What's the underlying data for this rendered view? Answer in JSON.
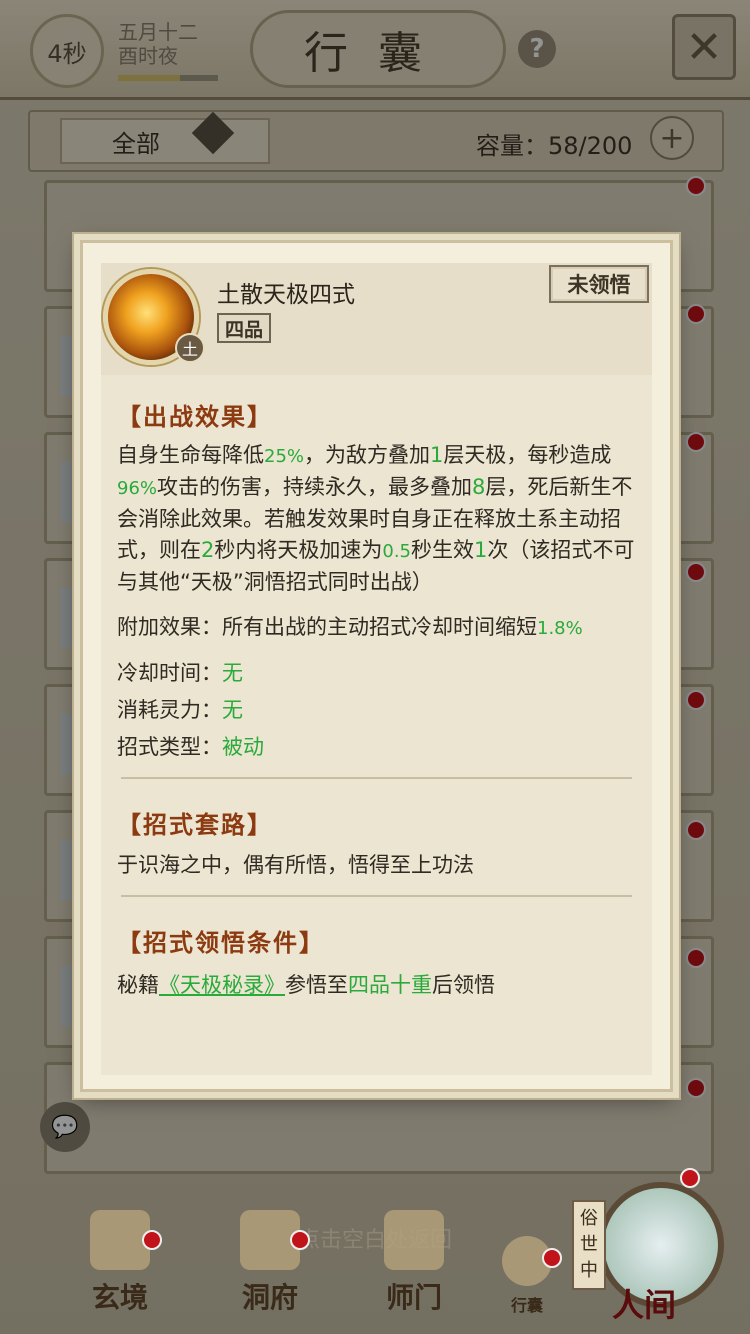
{
  "header": {
    "timer": "4秒",
    "date_line1": "五月十二",
    "date_line2": "酉时夜",
    "title": "行囊",
    "help_label": "?",
    "close_label": "✕"
  },
  "filter": {
    "selected": "全部",
    "capacity_label": "容量：",
    "capacity_value": "58/200"
  },
  "modal": {
    "skill_name": "土散天极四式",
    "grade": "四品",
    "element": "土",
    "status": "未领悟",
    "effect_title": "【出战效果】",
    "effect": {
      "t1": "自身生命每降低",
      "v1": "25%",
      "t2": "，为敌方叠加",
      "v2": "1",
      "t3": "层天极，每秒造成",
      "v3": "96%",
      "t4": "攻击的伤害，持续永久，最多叠加",
      "v4": "8",
      "t5": "层，死后新生不会消除此效果。若触发效果时自身正在释放土系主动招式，则在",
      "v5": "2",
      "t6": "秒内将天极加速为",
      "v6": "0.5",
      "t7": "秒生效",
      "v7": "1",
      "t8": "次（该招式不可与其他“天极”洞悟招式同时出战）"
    },
    "extra": {
      "label": "附加效果：所有出战的主动招式冷却时间缩短",
      "value": "1.8%"
    },
    "cooldown": {
      "label": "冷却时间：",
      "value": "无"
    },
    "cost": {
      "label": "消耗灵力：",
      "value": "无"
    },
    "type": {
      "label": "招式类型：",
      "value": "被动"
    },
    "routine_title": "【招式套路】",
    "routine_text": "于识海之中，偶有所悟，悟得至上功法",
    "condition_title": "【招式领悟条件】",
    "condition": {
      "prefix": "秘籍",
      "book": "《天极秘录》",
      "mid": "参悟至",
      "level": "四品十重",
      "suffix": "后领悟"
    }
  },
  "hint": "点击空白处返回",
  "bottom_nav": {
    "items": [
      "玄境",
      "洞府",
      "师门",
      "行囊"
    ],
    "world_label": "俗世中",
    "world_name": "人间"
  }
}
